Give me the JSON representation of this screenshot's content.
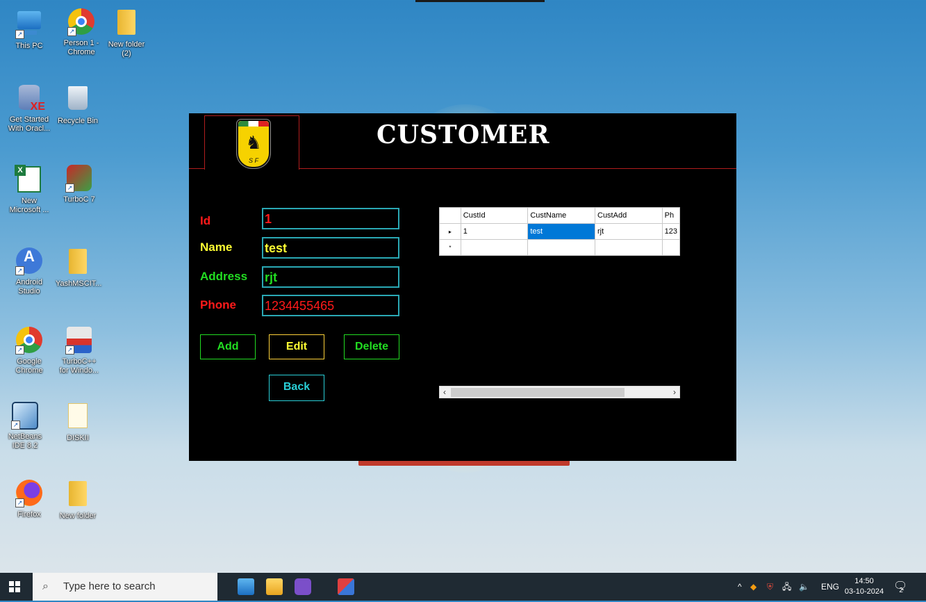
{
  "desktop": {
    "icons": [
      {
        "label": "This PC",
        "icon": "this-pc-icon"
      },
      {
        "label": "Person 1 - Chrome",
        "icon": "chrome-profile-icon"
      },
      {
        "label": "New folder (2)",
        "icon": "folder-icon"
      },
      {
        "label": "Get Started With Oracl...",
        "icon": "oracle-db-icon"
      },
      {
        "label": "Recycle Bin",
        "icon": "recycle-bin-icon"
      },
      {
        "label": "New Microsoft ...",
        "icon": "excel-icon"
      },
      {
        "label": "TurboC 7",
        "icon": "turboc-icon"
      },
      {
        "label": "Android Studio",
        "icon": "android-studio-icon"
      },
      {
        "label": "YashMSCIT...",
        "icon": "folder-icon"
      },
      {
        "label": "Google Chrome",
        "icon": "chrome-icon"
      },
      {
        "label": "TurboC++ for Windo...",
        "icon": "turbocpp-icon"
      },
      {
        "label": "NetBeans IDE 8.2",
        "icon": "netbeans-icon"
      },
      {
        "label": "DISKII",
        "icon": "document-icon"
      },
      {
        "label": "Firefox",
        "icon": "firefox-icon"
      },
      {
        "label": "New folder",
        "icon": "folder-icon"
      }
    ]
  },
  "app": {
    "title": "CUSTOMER",
    "logo_text": "S F",
    "form": {
      "id_label": "Id",
      "id_value": "1",
      "name_label": "Name",
      "name_value": "test",
      "address_label": "Address",
      "address_value": "rjt",
      "phone_label": "Phone",
      "phone_value": "1234455465"
    },
    "buttons": {
      "add": "Add",
      "edit": "Edit",
      "delete": "Delete",
      "back": "Back"
    },
    "grid": {
      "columns": [
        "CustId",
        "CustName",
        "CustAdd",
        "Ph"
      ],
      "rows": [
        [
          "1",
          "test",
          "rjt",
          "123"
        ]
      ],
      "new_row_marker": "*",
      "current_row_marker": "▸"
    },
    "colors": {
      "id": "#ff1a1a",
      "name": "#ffff33",
      "address": "#22dd22",
      "phone": "#ff1a1a",
      "field_border": "#2aa8b4",
      "header_line": "#b01d1d"
    }
  },
  "taskbar": {
    "search_placeholder": "Type here to search",
    "language": "ENG",
    "time": "14:50",
    "date": "03-10-2024",
    "notification_count": "2"
  }
}
